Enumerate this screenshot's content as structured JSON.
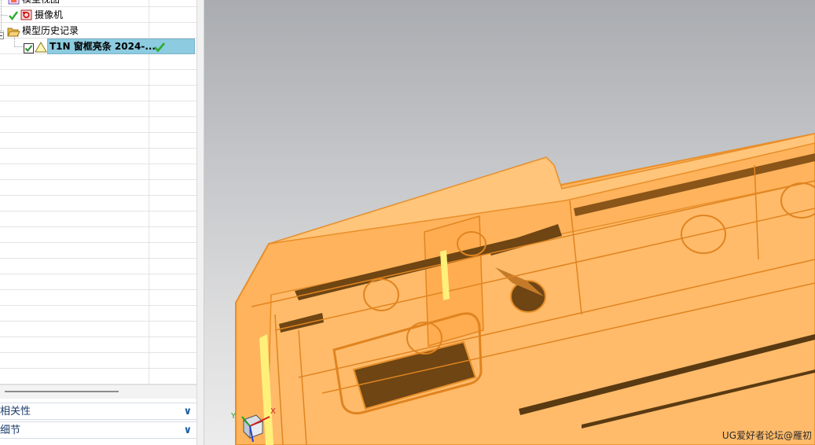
{
  "tree": {
    "items": [
      {
        "label": "模型视图"
      },
      {
        "label": "摄像机"
      },
      {
        "label": "模型历史记录"
      },
      {
        "label": "T1N 窗框亮条 2024-..."
      }
    ]
  },
  "panels": {
    "dependencies_label": "相关性",
    "details_label": "细节"
  },
  "triad": {
    "x": "X",
    "y": "Y"
  },
  "watermark": "UG爱好者论坛@雁初",
  "colors": {
    "model_fill": "#ffb35c",
    "model_edge": "#e88f2a",
    "selection": "#8ccbe0",
    "check_green": "#2eaa2e"
  }
}
